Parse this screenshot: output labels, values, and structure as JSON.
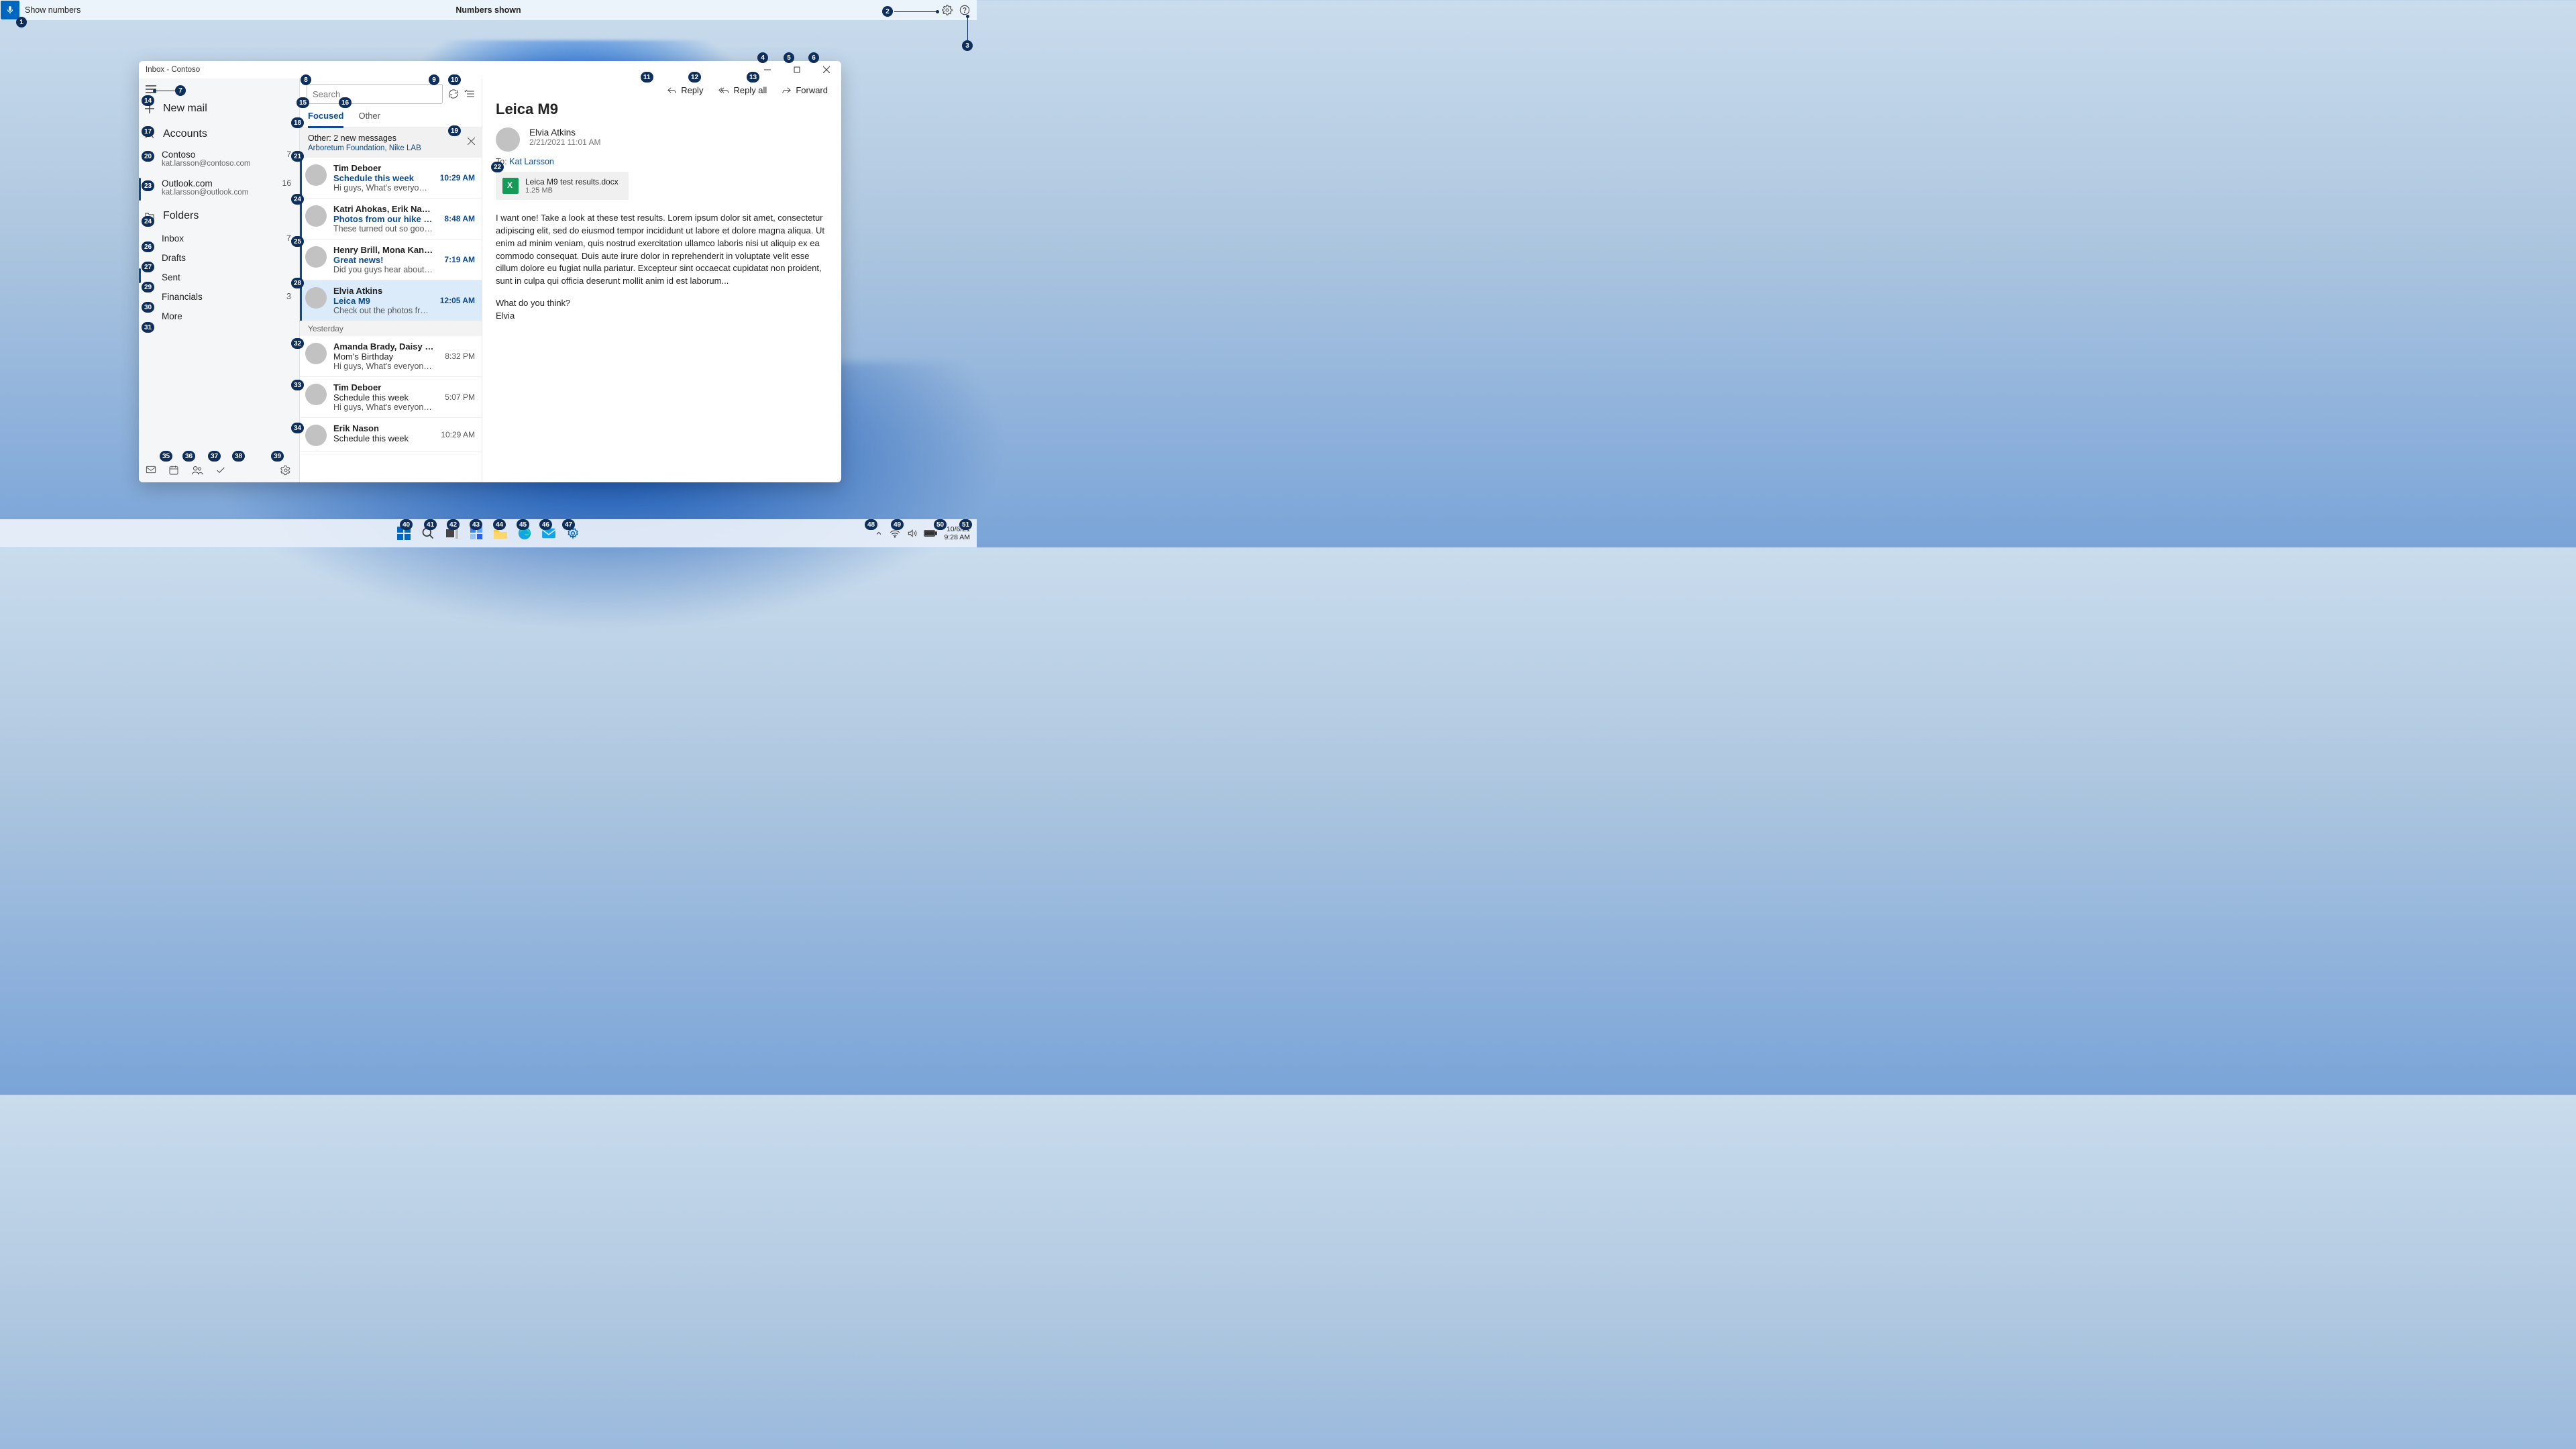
{
  "voicebar": {
    "left": "Show numbers",
    "center": "Numbers shown"
  },
  "window": {
    "title": "Inbox - Contoso"
  },
  "nav": {
    "newmail": "New mail",
    "accounts_header": "Accounts",
    "accounts": [
      {
        "name": "Contoso",
        "email": "kat.larsson@contoso.com",
        "count": "7"
      },
      {
        "name": "Outlook.com",
        "email": "kat.larsson@outlook.com",
        "count": "16"
      }
    ],
    "folders_header": "Folders",
    "folders": [
      {
        "name": "Inbox",
        "count": "7"
      },
      {
        "name": "Drafts",
        "count": ""
      },
      {
        "name": "Sent",
        "count": ""
      },
      {
        "name": "Financials",
        "count": "3"
      },
      {
        "name": "More",
        "count": ""
      }
    ]
  },
  "list": {
    "search_placeholder": "Search",
    "tabs": {
      "focused": "Focused",
      "other": "Other"
    },
    "other_banner_title": "Other: 2 new messages",
    "other_banner_sub": "Arboretum Foundation, Nike LAB",
    "day_header": "Yesterday",
    "msgs": [
      {
        "sender": "Tim Deboer",
        "subject": "Schedule this week",
        "preview": "Hi guys, What's everyone's sche",
        "time": "10:29 AM",
        "unread": true
      },
      {
        "sender": "Katri Ahokas, Erik Nason",
        "subject": "Photos from our hike on Maple",
        "preview": "These turned out so good! xx",
        "time": "8:48 AM",
        "unread": true
      },
      {
        "sender": "Henry Brill, Mona Kane, Cecil Fo",
        "subject": "Great news!",
        "preview": "Did you guys hear about Robin's",
        "time": "7:19 AM",
        "unread": true
      },
      {
        "sender": "Elvia Atkins",
        "subject": "Leica M9",
        "preview": "Check out the photos from this v",
        "time": "12:05 AM",
        "unread": true,
        "selected": true
      },
      {
        "sender": "Amanda Brady, Daisy Phillips",
        "subject": "Mom's Birthday",
        "preview": "Hi guys, What's everyone's sche",
        "time": "8:32 PM"
      },
      {
        "sender": "Tim Deboer",
        "subject": "Schedule this week",
        "preview": "Hi guys, What's everyone's sche",
        "time": "5:07 PM"
      },
      {
        "sender": "Erik Nason",
        "subject": "Schedule this week",
        "preview": "",
        "time": "10:29 AM"
      }
    ]
  },
  "read": {
    "reply": "Reply",
    "replyall": "Reply all",
    "forward": "Forward",
    "subject": "Leica M9",
    "from": "Elvia Atkins",
    "date": "2/21/2021 11:01 AM",
    "to_label": "To:",
    "to_name": "Kat Larsson",
    "attach_name": "Leica M9 test results.docx",
    "attach_size": "1.25 MB",
    "body_p1": "I want one! Take a look at these test results. Lorem ipsum dolor sit amet, consectetur adipiscing elit, sed do eiusmod tempor incididunt ut labore et dolore magna aliqua. Ut enim ad minim veniam, quis nostrud exercitation ullamco laboris nisi ut aliquip ex ea commodo consequat. Duis aute irure dolor in reprehenderit in voluptate velit esse cillum dolore eu fugiat nulla pariatur. Excepteur sint occaecat cupidatat non proident, sunt in culpa qui officia deserunt mollit anim id est laborum...",
    "body_p2": "What do you think?",
    "body_p3": "Elvia"
  },
  "taskbar": {
    "date": "10/6/21",
    "time": "9:28 AM"
  },
  "badges": {
    "b1": "1",
    "b2": "2",
    "b3": "3",
    "b4": "4",
    "b5": "5",
    "b6": "6",
    "b7": "7",
    "b8": "8",
    "b9": "9",
    "b10": "10",
    "b11": "11",
    "b12": "12",
    "b13": "13",
    "b14": "14",
    "b15": "15",
    "b16": "16",
    "b17": "17",
    "b18": "18",
    "b19": "19",
    "b20": "20",
    "b21": "21",
    "b22": "22",
    "b23": "23",
    "b24a": "24",
    "b24b": "24",
    "b25": "25",
    "b26": "26",
    "b27": "27",
    "b28": "28",
    "b29": "29",
    "b30": "30",
    "b31": "31",
    "b32": "32",
    "b33": "33",
    "b34": "34",
    "b35": "35",
    "b36": "36",
    "b37": "37",
    "b38": "38",
    "b39": "39",
    "b40": "40",
    "b41": "41",
    "b42": "42",
    "b43": "43",
    "b44": "44",
    "b45": "45",
    "b46": "46",
    "b47": "47",
    "b48": "48",
    "b49": "49",
    "b50": "50",
    "b51": "51"
  }
}
